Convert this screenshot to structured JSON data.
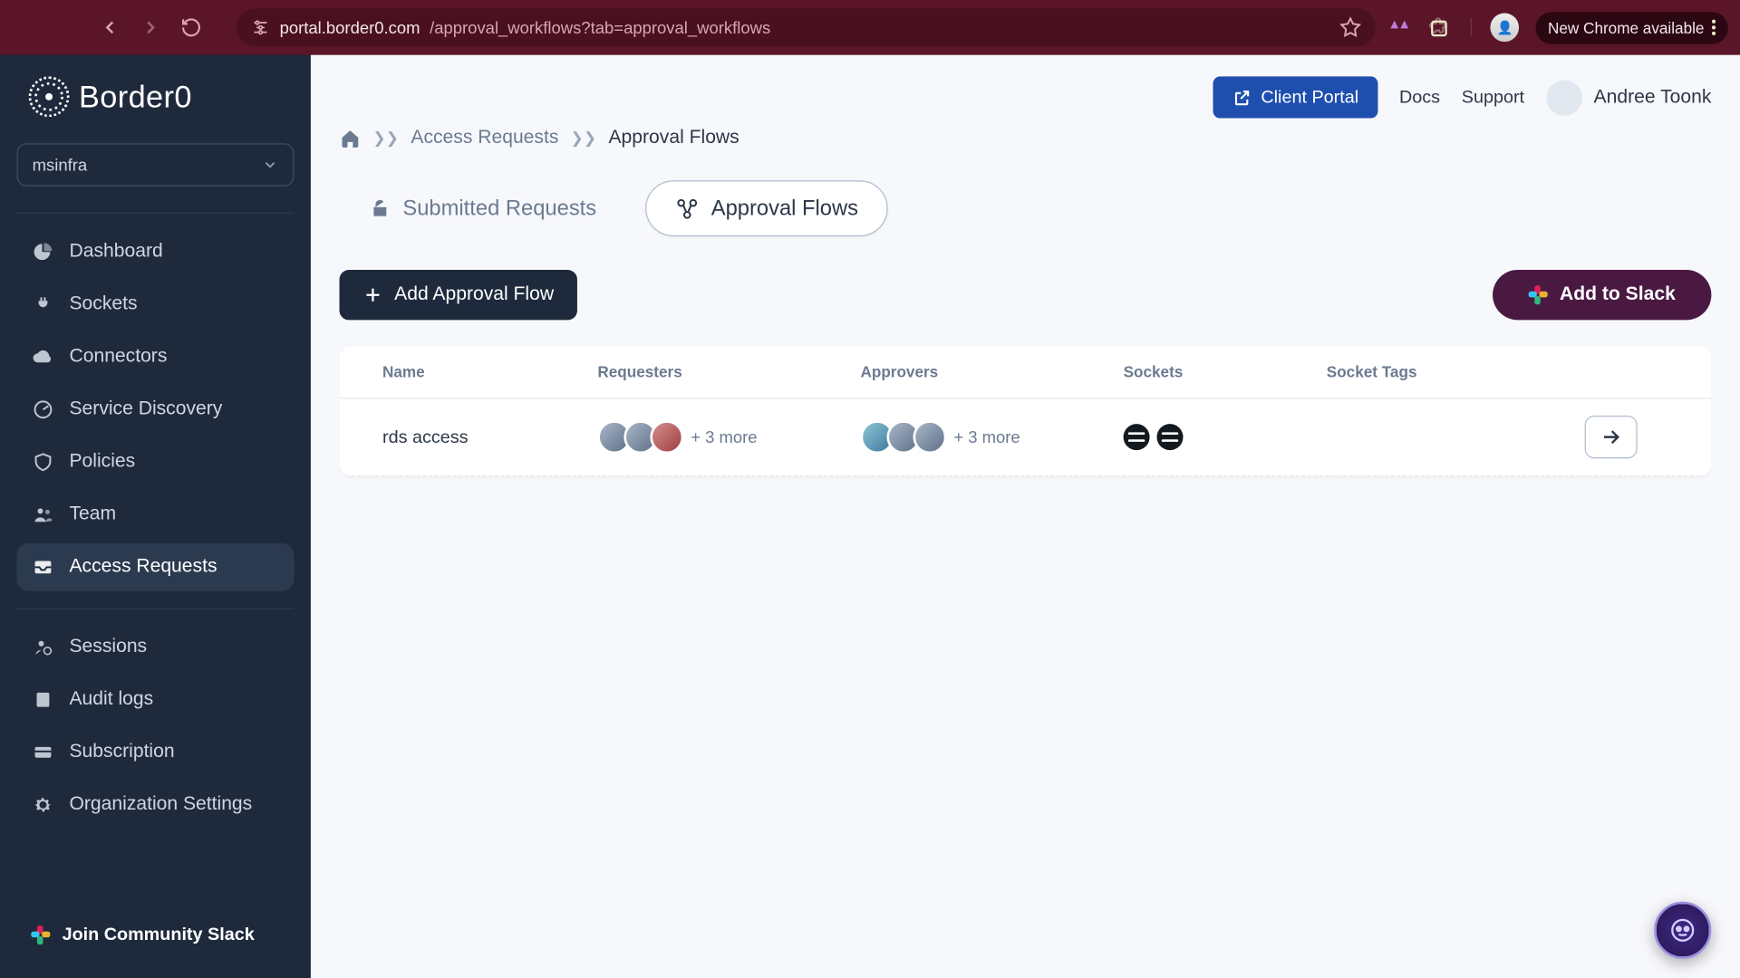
{
  "browser": {
    "url_host": "portal.border0.com",
    "url_path": "/approval_workflows?tab=approval_workflows",
    "update_label": "New Chrome available"
  },
  "brand": {
    "name": "Border0"
  },
  "org_selector": {
    "value": "msinfra"
  },
  "sidebar": {
    "items": [
      {
        "label": "Dashboard"
      },
      {
        "label": "Sockets"
      },
      {
        "label": "Connectors"
      },
      {
        "label": "Service Discovery"
      },
      {
        "label": "Policies"
      },
      {
        "label": "Team"
      },
      {
        "label": "Access Requests"
      }
    ],
    "secondary": [
      {
        "label": "Sessions"
      },
      {
        "label": "Audit logs"
      },
      {
        "label": "Subscription"
      },
      {
        "label": "Organization Settings"
      }
    ],
    "join_slack": "Join Community Slack"
  },
  "header": {
    "client_portal": "Client Portal",
    "docs": "Docs",
    "support": "Support",
    "user_name": "Andree Toonk"
  },
  "breadcrumbs": {
    "item1": "Access Requests",
    "item2": "Approval Flows"
  },
  "tabs": {
    "submitted": "Submitted Requests",
    "approval": "Approval Flows"
  },
  "actions": {
    "add": "Add Approval Flow",
    "slack": "Add to Slack"
  },
  "table": {
    "headers": {
      "name": "Name",
      "requesters": "Requesters",
      "approvers": "Approvers",
      "sockets": "Sockets",
      "socket_tags": "Socket Tags"
    },
    "rows": [
      {
        "name": "rds access",
        "requesters_more": "+ 3 more",
        "approvers_more": "+ 3 more"
      }
    ]
  },
  "colors": {
    "sidebar_bg": "#1e2a3c",
    "accent_blue": "#1f4fae",
    "slack_purple": "#4a1942",
    "browser_bar": "#5b1528"
  }
}
